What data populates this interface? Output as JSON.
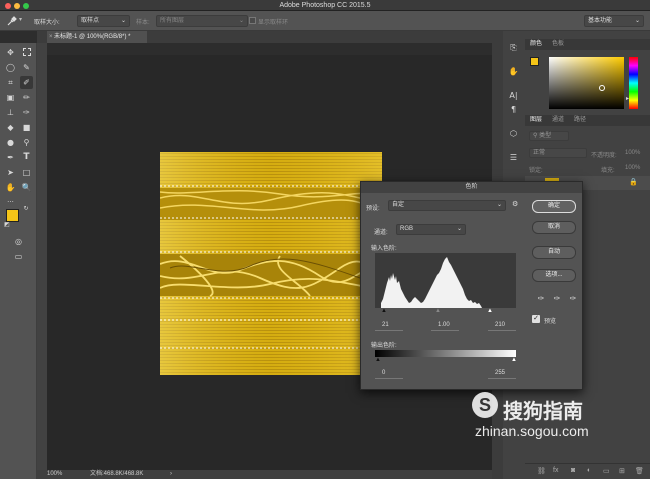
{
  "window": {
    "title": "Adobe Photoshop CC 2015.5"
  },
  "options_bar": {
    "sample_size_label": "取样大小:",
    "sample_size_value": "取样点",
    "sample_label": "样本:",
    "sample_value": "所有图层",
    "show_ring_label": "显示取样环",
    "workspace": "基本功能"
  },
  "document": {
    "tab_title": "未标题-1 @ 100%(RGB/8*) *",
    "zoom": "100%",
    "doc_info": "文档:468.8K/468.8K"
  },
  "right_panel": {
    "tabs_top": [
      "颜色",
      "色板"
    ],
    "tabs_layers": [
      "图层",
      "通道",
      "路径"
    ],
    "filter_kind": "类型",
    "blend_mode": "正常",
    "opacity_label": "不透明度:",
    "opacity_value": "100%",
    "lock_label": "锁定:",
    "fill_label": "填充:",
    "fill_value": "100%"
  },
  "levels_dialog": {
    "title": "色阶",
    "preset_label": "预设:",
    "preset_value": "自定",
    "channel_label": "通道:",
    "channel_value": "RGB",
    "input_label": "输入色阶:",
    "input_black": "21",
    "input_gamma": "1.00",
    "input_white": "210",
    "output_label": "输出色阶:",
    "output_black": "0",
    "output_white": "255",
    "buttons": {
      "ok": "确定",
      "cancel": "取消",
      "auto": "自动",
      "options": "选项..."
    },
    "preview_label": "预览",
    "preview_checked": true
  },
  "watermark": {
    "brand": "搜狗指南",
    "url": "zhinan.sogou.com"
  },
  "colors": {
    "accent_blue": "#2a7bd5",
    "foreground": "#f5c518",
    "background": "#2a1d05"
  }
}
